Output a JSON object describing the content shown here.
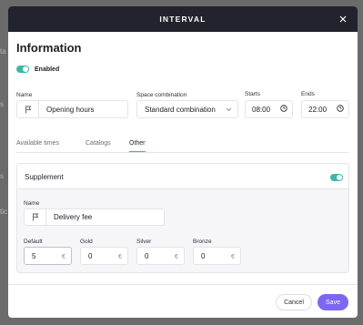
{
  "background": {
    "hints": [
      "ta",
      "s",
      "s",
      "tic"
    ]
  },
  "modal": {
    "title": "INTERVAL",
    "section_title": "Information",
    "enabled_label": "Enabled",
    "name_label": "Name",
    "name_value": "Opening hours",
    "space_label": "Space combination",
    "space_value": "Standard combination",
    "starts_label": "Starts",
    "starts_value": "08:00",
    "ends_label": "Ends",
    "ends_value": "22:00",
    "tabs": [
      {
        "label": "Available times",
        "active": false
      },
      {
        "label": "Catalogs",
        "active": false
      },
      {
        "label": "Other",
        "active": true
      }
    ],
    "supplement": {
      "title": "Supplement",
      "enabled": true,
      "name_label": "Name",
      "name_value": "Delivery fee",
      "default_label": "Default",
      "default_value": "5",
      "gold_label": "Gold",
      "gold_value": "0",
      "silver_label": "Silver",
      "silver_value": "0",
      "bronze_label": "Bronze",
      "bronze_value": "0",
      "currency": "€"
    },
    "cancel_label": "Cancel",
    "save_label": "Save"
  },
  "colors": {
    "header_bg": "#22232d",
    "toggle_on": "#3fb7a6",
    "save_button": "#7c68f0"
  },
  "icons": [
    "close-icon",
    "flag-icon",
    "chevron-down-icon",
    "clock-icon"
  ]
}
